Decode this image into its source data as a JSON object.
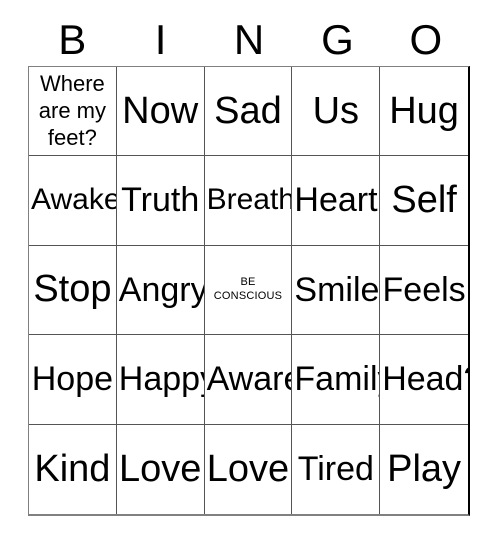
{
  "card": {
    "title": "BINGO",
    "header_letters": [
      "B",
      "I",
      "N",
      "G",
      "O"
    ],
    "free_space_label": "BE\nCONSCIOUS",
    "colors": {
      "background": "#ffffff",
      "text": "#000000",
      "grid_line": "#555555",
      "grid_outer": "#808080"
    },
    "rows": [
      [
        {
          "text": "Where\nare my\nfeet?",
          "size": "sm",
          "free_space": false
        },
        {
          "text": "Now",
          "size": "xl",
          "free_space": false
        },
        {
          "text": "Sad",
          "size": "xl",
          "free_space": false
        },
        {
          "text": "Us",
          "size": "xl",
          "free_space": false
        },
        {
          "text": "Hug",
          "size": "xl",
          "free_space": false
        }
      ],
      [
        {
          "text": "Awake",
          "size": "md",
          "free_space": false
        },
        {
          "text": "Truth",
          "size": "lg",
          "free_space": false
        },
        {
          "text": "Breath",
          "size": "md",
          "free_space": false
        },
        {
          "text": "Heart",
          "size": "lg",
          "free_space": false
        },
        {
          "text": "Self",
          "size": "xl",
          "free_space": false
        }
      ],
      [
        {
          "text": "Stop",
          "size": "xl",
          "free_space": false
        },
        {
          "text": "Angry",
          "size": "lg",
          "free_space": false
        },
        {
          "text": "BE\nCONSCIOUS",
          "size": "xs",
          "free_space": true
        },
        {
          "text": "Smile",
          "size": "lg",
          "free_space": false
        },
        {
          "text": "Feels",
          "size": "lg",
          "free_space": false
        }
      ],
      [
        {
          "text": "Hope",
          "size": "lg",
          "free_space": false
        },
        {
          "text": "Happy",
          "size": "lg",
          "free_space": false
        },
        {
          "text": "Aware",
          "size": "lg",
          "free_space": false
        },
        {
          "text": "Family",
          "size": "lg",
          "free_space": false
        },
        {
          "text": "Head?",
          "size": "lg",
          "free_space": false
        }
      ],
      [
        {
          "text": "Kind",
          "size": "xl",
          "free_space": false
        },
        {
          "text": "Love",
          "size": "xl",
          "free_space": false
        },
        {
          "text": "Love",
          "size": "xl",
          "free_space": false
        },
        {
          "text": "Tired",
          "size": "lg",
          "free_space": false
        },
        {
          "text": "Play",
          "size": "xl",
          "free_space": false
        }
      ]
    ]
  }
}
